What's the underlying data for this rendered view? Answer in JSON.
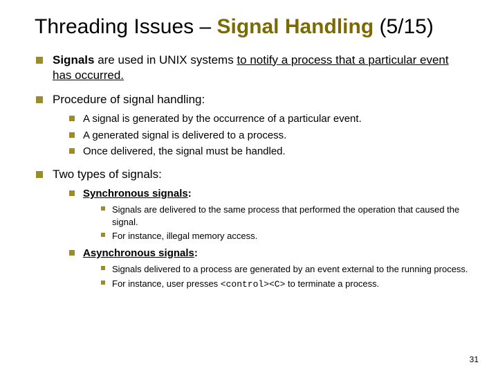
{
  "title_plain": "Threading Issues – ",
  "title_accent": "Signal Handling",
  "title_tail": " (5/15)",
  "b1_lead": "Signals",
  "b1_rest": " are used in UNIX systems ",
  "b1_under": "to notify a process that a particular event has occurred.",
  "b2": "Procedure of signal handling:",
  "b2_sub": [
    "A signal is generated by the occurrence of a particular event.",
    "A generated signal is delivered to a process.",
    "Once delivered, the signal must be handled."
  ],
  "b3": "Two types of signals:",
  "b3_sync_label": "Synchronous signals",
  "b3_sync_colon": ":",
  "b3_sync_items": [
    "Signals are delivered to the same process that performed the operation that caused the signal.",
    "For instance, illegal memory access."
  ],
  "b3_async_label": "Asynchronous signals",
  "b3_async_colon": ":",
  "b3_async_lead": "Signals delivered to a process are generated by an event external to the running process.",
  "b3_async_ex_pre": "For instance, user presses ",
  "b3_async_ex_code": "<control><C>",
  "b3_async_ex_post": " to terminate a process.",
  "page_number": "31"
}
